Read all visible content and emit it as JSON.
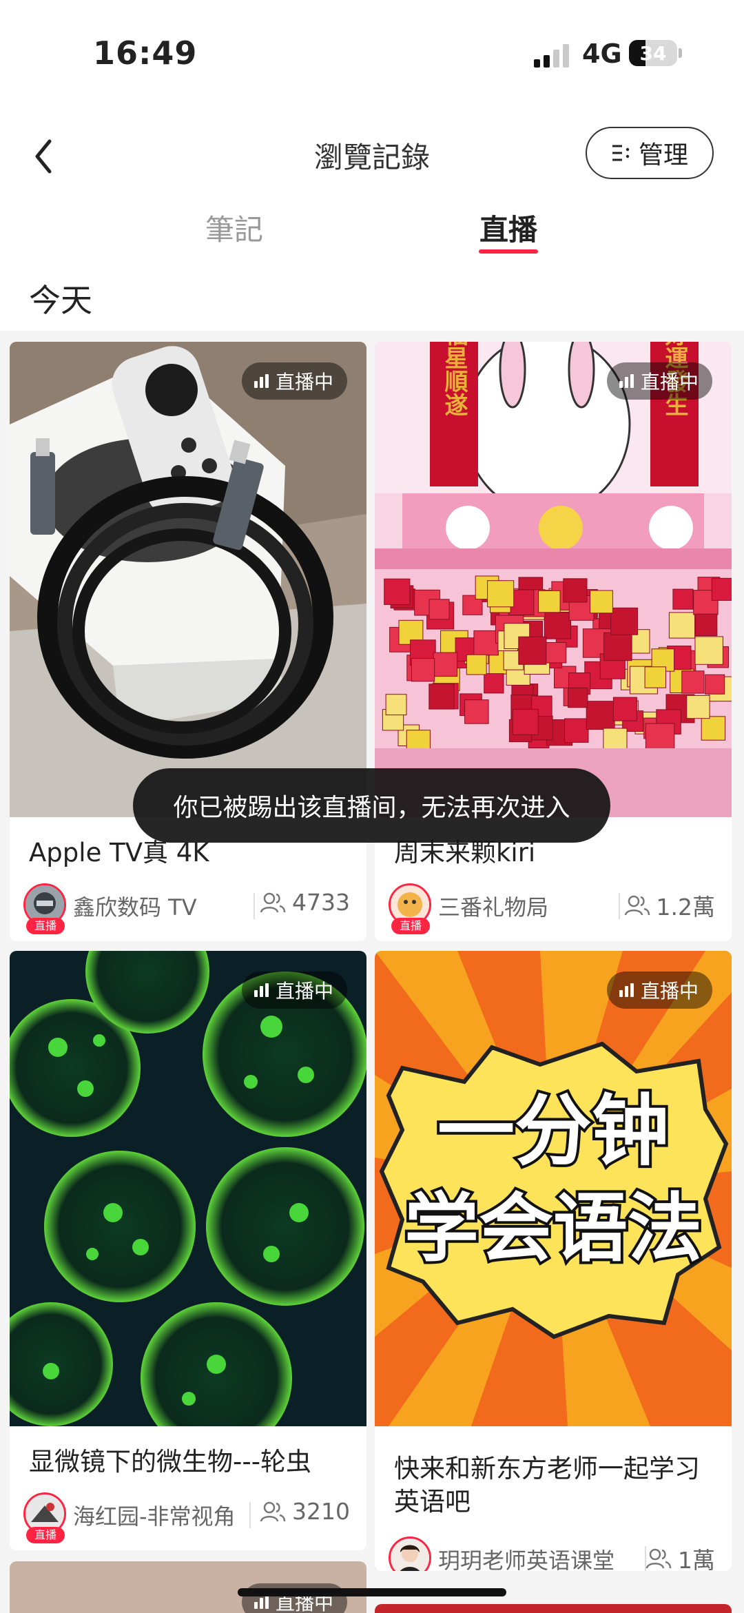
{
  "status_bar": {
    "time": "16:49",
    "network": "4G",
    "battery": "34",
    "battery_level": 0.34
  },
  "header": {
    "title": "瀏覽記錄",
    "manage_label": "管理"
  },
  "tabs": [
    {
      "label": "筆記",
      "active": false
    },
    {
      "label": "直播",
      "active": true
    }
  ],
  "section_date": "今天",
  "live_badge_label": "直播中",
  "live_tag_label": "直播",
  "cards": [
    {
      "title": "Apple TV真 4K",
      "author": "鑫欣数码 TV",
      "viewers": "4733"
    },
    {
      "title": "周末来颗kiri",
      "author": "三番礼物局",
      "viewers": "1.2萬"
    },
    {
      "title": "显微镜下的微生物---轮虫",
      "author": "海红园-非常视角",
      "viewers": "3210"
    },
    {
      "title": "快来和新东方老师一起学习英语吧",
      "author": "玥玥老师英语课堂",
      "viewers": "1萬"
    }
  ],
  "cover_texts": {
    "english_line1": "一分钟",
    "english_line2": "学会语法",
    "gift_banner_left": "福星順遂",
    "gift_banner_right": "好運發生"
  },
  "toast": "你已被踢出该直播间，无法再次进入",
  "colors": {
    "accent": "#ff2442",
    "page_bg": "#f4f4f4"
  }
}
